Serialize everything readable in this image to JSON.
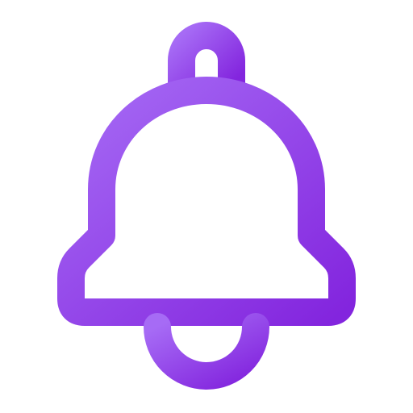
{
  "icon": {
    "name": "bell-icon",
    "style": "outline",
    "gradient": {
      "start": "#A66BF5",
      "end": "#8325DE"
    },
    "background": "#FFFFFF"
  }
}
